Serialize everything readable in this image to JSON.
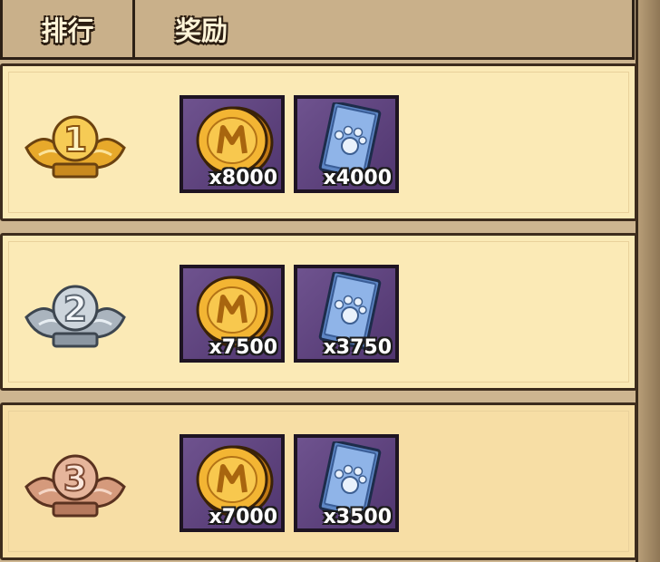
{
  "header": {
    "rank_label": "排行",
    "reward_label": "奖励"
  },
  "rows": [
    {
      "rank": "1",
      "medal": "gold-rank-medal",
      "rewards": [
        {
          "icon": "gold-coin-icon",
          "quantity": "x8000"
        },
        {
          "icon": "paw-ticket-icon",
          "quantity": "x4000"
        }
      ]
    },
    {
      "rank": "2",
      "medal": "silver-rank-medal",
      "rewards": [
        {
          "icon": "gold-coin-icon",
          "quantity": "x7500"
        },
        {
          "icon": "paw-ticket-icon",
          "quantity": "x3750"
        }
      ]
    },
    {
      "rank": "3",
      "medal": "bronze-rank-medal",
      "rewards": [
        {
          "icon": "gold-coin-icon",
          "quantity": "x7000"
        },
        {
          "icon": "paw-ticket-icon",
          "quantity": "x3500"
        }
      ]
    }
  ],
  "colors": {
    "gold": "#e9b23a",
    "silver": "#b9c3cc",
    "bronze": "#d9a286",
    "slot_purple": "#5e3f82",
    "row_bg": "#fbeab6"
  }
}
